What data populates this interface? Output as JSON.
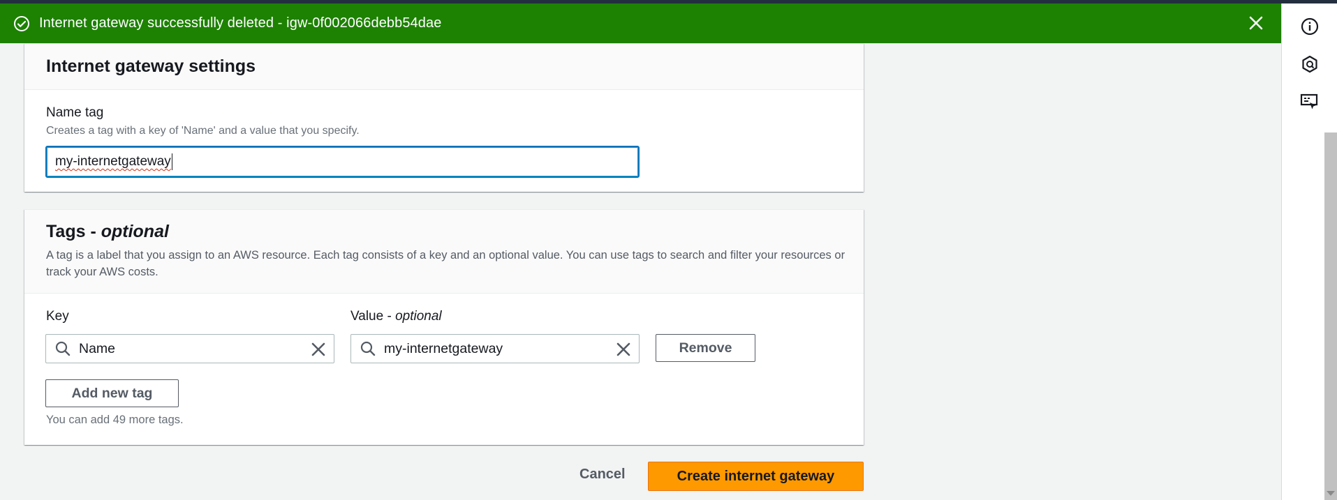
{
  "flash": {
    "message": "Internet gateway successfully deleted - igw-0f002066debb54dae",
    "type": "success",
    "color": "#1d8102"
  },
  "settings": {
    "heading": "Internet gateway settings",
    "name_tag": {
      "label": "Name tag",
      "description": "Creates a tag with a key of 'Name' and a value that you specify.",
      "value": "my-internetgateway"
    }
  },
  "tags": {
    "heading": "Tags - ",
    "heading_optional": "optional",
    "description": "A tag is a label that you assign to an AWS resource. Each tag consists of a key and an optional value. You can use tags to search and filter your resources or track your AWS costs.",
    "key_label": "Key",
    "value_label": "Value - ",
    "value_label_optional": "optional",
    "rows": [
      {
        "key": "Name",
        "value": "my-internetgateway",
        "remove_label": "Remove"
      }
    ],
    "add_label": "Add new tag",
    "hint": "You can add 49 more tags."
  },
  "actions": {
    "cancel_label": "Cancel",
    "create_label": "Create internet gateway",
    "primary_color": "#ff9900"
  },
  "rail": {
    "icons": [
      "info-icon",
      "feedback-icon",
      "tutorial-icon"
    ]
  }
}
